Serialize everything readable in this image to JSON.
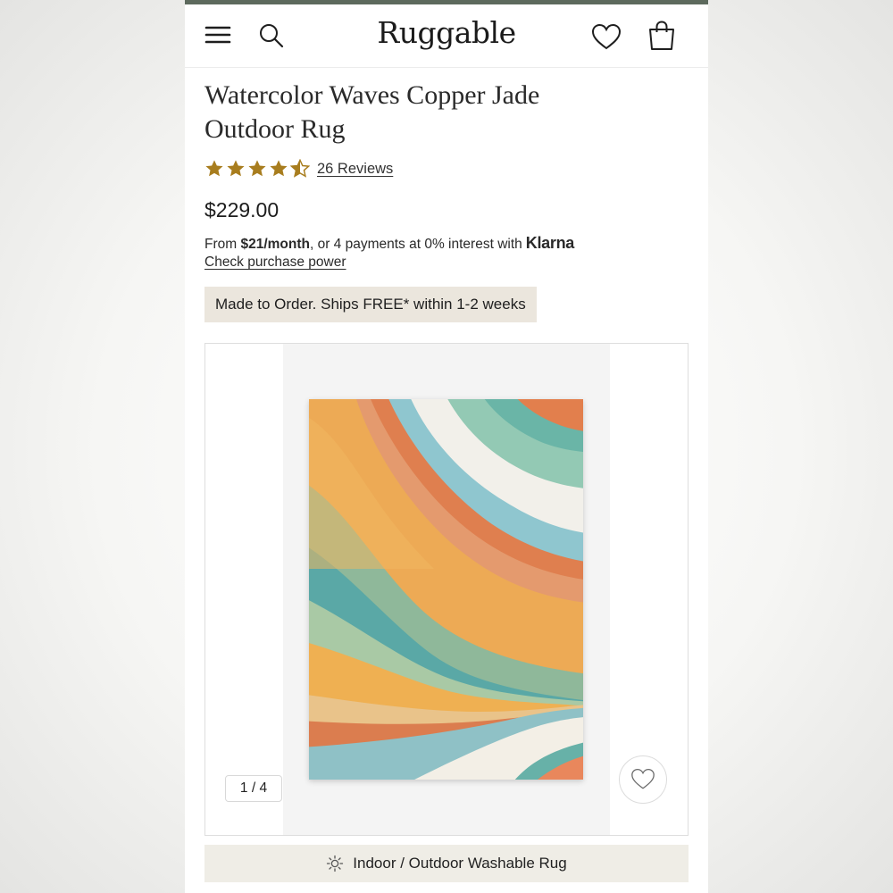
{
  "header": {
    "logo": "Ruggable",
    "icons": [
      "menu-icon",
      "search-icon",
      "heart-icon",
      "shopping-bag-icon"
    ]
  },
  "product": {
    "title": "Watercolor Waves Copper Jade Outdoor Rug",
    "rating": 4.5,
    "reviews_label": "26 Reviews",
    "price": "$229.00",
    "financing": {
      "prefix": "From ",
      "monthly": "$21/month",
      "suffix": ", or 4 payments at 0% interest with",
      "provider": "Klarna",
      "link": "Check purchase power"
    },
    "shipping_badge": "Made to Order. Ships FREE* within 1-2 weeks"
  },
  "gallery": {
    "counter": "1 / 4"
  },
  "feature_bar": {
    "label": "Indoor / Outdoor Washable Rug",
    "icon": "sun-icon"
  },
  "colors": {
    "star": "#a87d1e",
    "badge_bg": "#ebe6dd",
    "feature_bg": "#efede6",
    "top_strip": "#5d6a5d"
  }
}
